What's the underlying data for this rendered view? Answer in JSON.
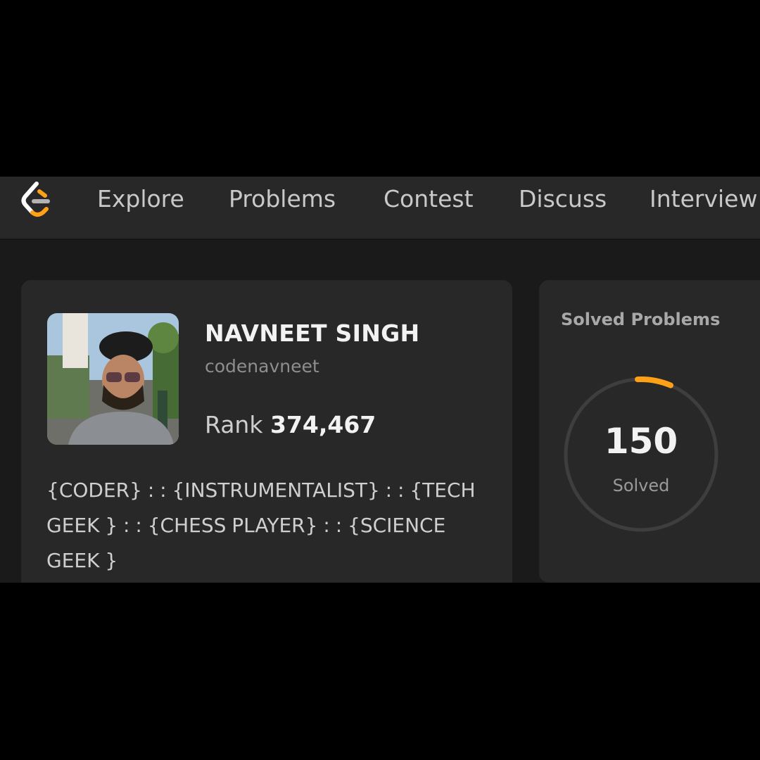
{
  "nav": {
    "items": [
      "Explore",
      "Problems",
      "Contest",
      "Discuss",
      "Interview"
    ]
  },
  "profile": {
    "name": "NAVNEET SINGH",
    "username": "codenavneet",
    "rank_label": "Rank",
    "rank_value": "374,467",
    "bio": "{CODER} : : {INSTRUMENTALIST} : : {TECH GEEK } : : {CHESS PLAYER} : : {SCIENCE GEEK }"
  },
  "solved": {
    "title": "Solved Problems",
    "count": "150",
    "label": "Solved"
  },
  "colors": {
    "accent": "#ffa116",
    "background": "#1a1a1a",
    "card": "#282828"
  }
}
